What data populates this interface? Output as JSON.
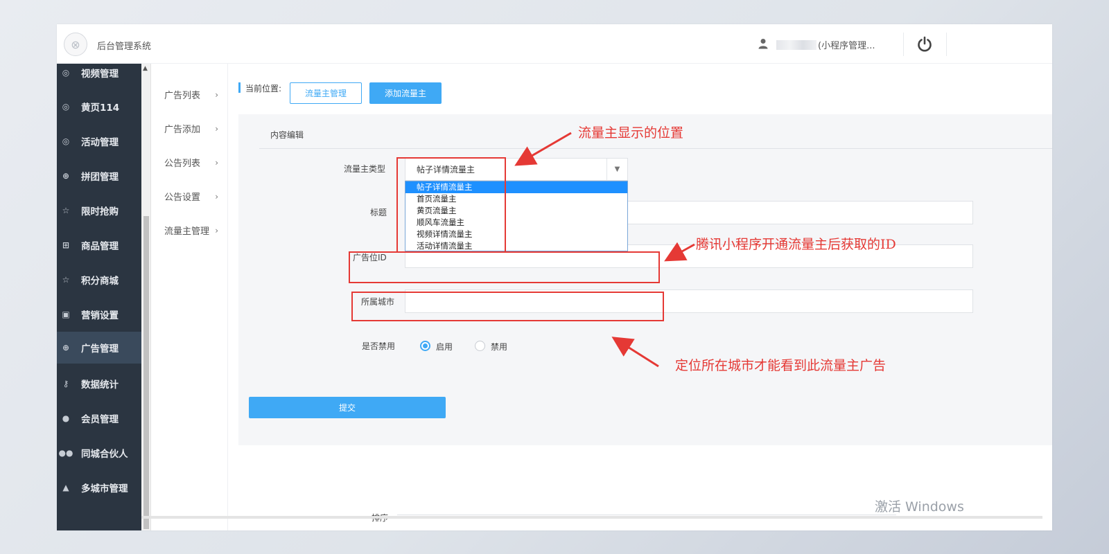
{
  "header": {
    "app_title": "后台管理系统",
    "user_name": "(小程序管理..."
  },
  "sidebar": {
    "items": [
      {
        "label": "视频管理",
        "icon": "compass-icon"
      },
      {
        "label": "黄页114",
        "icon": "compass-icon"
      },
      {
        "label": "活动管理",
        "icon": "compass-icon"
      },
      {
        "label": "拼团管理",
        "icon": "lifebuoy-icon"
      },
      {
        "label": "限时抢购",
        "icon": "star-icon"
      },
      {
        "label": "商品管理",
        "icon": "cart-icon"
      },
      {
        "label": "积分商城",
        "icon": "star-icon"
      },
      {
        "label": "营销设置",
        "icon": "gift-icon"
      },
      {
        "label": "广告管理",
        "icon": "lifebuoy-icon",
        "active": true
      },
      {
        "label": "数据统计",
        "icon": "key-icon"
      },
      {
        "label": "会员管理",
        "icon": "user-icon"
      },
      {
        "label": "同城合伙人",
        "icon": "users-icon"
      },
      {
        "label": "多城市管理",
        "icon": "graduation-cap-icon"
      }
    ]
  },
  "submenu": {
    "items": [
      {
        "label": "广告列表"
      },
      {
        "label": "广告添加"
      },
      {
        "label": "公告列表"
      },
      {
        "label": "公告设置"
      },
      {
        "label": "流量主管理"
      }
    ]
  },
  "breadcrumb": {
    "label": "当前位置:",
    "outline_button": "流量主管理",
    "solid_button": "添加流量主"
  },
  "form": {
    "section_title": "内容编辑",
    "type_label": "流量主类型",
    "type_value": "帖子详情流量主",
    "type_options": [
      "帖子详情流量主",
      "首页流量主",
      "黄页流量主",
      "顺风车流量主",
      "视频详情流量主",
      "活动详情流量主"
    ],
    "title_label": "标题",
    "ad_id_label": "广告位ID",
    "city_label": "所属城市",
    "enable_label": "是否禁用",
    "enable_on": "启用",
    "enable_off": "禁用",
    "submit": "提交",
    "sort_label": "排序"
  },
  "annotations": {
    "position_note": "流量主显示的位置",
    "id_note": "腾讯小程序开通流量主后获取的ID",
    "city_note": "定位所在城市才能看到此流量主广告",
    "color": "#e53935"
  },
  "watermark": "激活 Windows",
  "colors": {
    "accent": "#3fa9f5",
    "sidebar_bg": "#2b3541",
    "sidebar_active": "#3a4a5c"
  }
}
